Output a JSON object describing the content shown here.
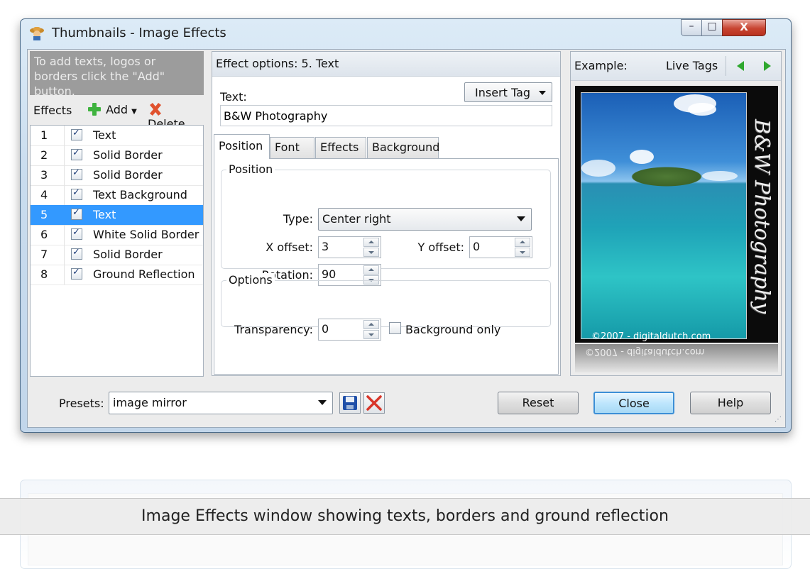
{
  "window": {
    "title": "Thumbnails - Image Effects",
    "controls": {
      "minimize": "–",
      "maximize": "□",
      "close": "X"
    }
  },
  "left_panel": {
    "info": "To add texts, logos or borders click the \"Add\" button.",
    "effects_label": "Effects",
    "add_label": "Add",
    "delete_label": "Delete",
    "items": [
      {
        "num": "1",
        "checked": true,
        "label": "Text"
      },
      {
        "num": "2",
        "checked": true,
        "label": "Solid Border"
      },
      {
        "num": "3",
        "checked": true,
        "label": "Solid Border"
      },
      {
        "num": "4",
        "checked": true,
        "label": "Text Background"
      },
      {
        "num": "5",
        "checked": true,
        "label": "Text",
        "selected": true
      },
      {
        "num": "6",
        "checked": true,
        "label": "White Solid Border"
      },
      {
        "num": "7",
        "checked": true,
        "label": "Solid Border"
      },
      {
        "num": "8",
        "checked": true,
        "label": "Ground Reflection"
      }
    ]
  },
  "effect_options": {
    "header": "Effect options: 5. Text",
    "text_label": "Text:",
    "insert_tag": "Insert Tag",
    "text_value": "B&W Photography",
    "tabs": [
      "Position",
      "Font",
      "Effects",
      "Background"
    ],
    "active_tab": "Position",
    "position_group": "Position",
    "type_label": "Type:",
    "type_value": "Center right",
    "x_offset_label": "X offset:",
    "x_offset_value": "3",
    "y_offset_label": "Y offset:",
    "y_offset_value": "0",
    "rotation_label": "Rotation:",
    "rotation_value": "90",
    "options_group": "Options",
    "transparency_label": "Transparency:",
    "transparency_value": "0",
    "background_only_label": "Background only",
    "background_only_checked": false
  },
  "example": {
    "label": "Example:",
    "live_tags": "Live Tags",
    "overlay_text": "B&W Photography",
    "copyright": "©2007 - digitaldutch.com"
  },
  "bottom": {
    "presets_label": "Presets:",
    "presets_value": "image mirror",
    "reset": "Reset",
    "close": "Close",
    "help": "Help"
  },
  "caption": "Image Effects window showing texts, borders and ground reflection",
  "colors": {
    "selection": "#3399ff",
    "add_icon": "#3fb33f",
    "delete_icon": "#e0522e",
    "nav_arrow": "#2fa82f",
    "save_icon": "#1f4fa8"
  }
}
